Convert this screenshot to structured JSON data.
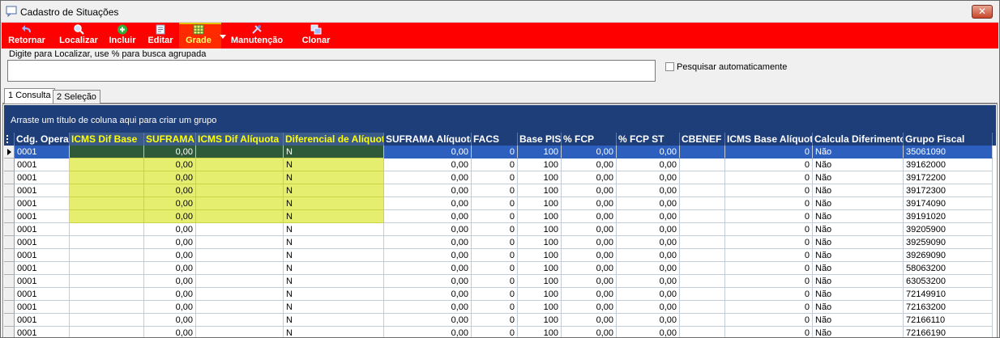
{
  "window": {
    "title": "Cadastro de Situações",
    "close_label": "✕"
  },
  "toolbar": {
    "buttons": [
      {
        "label": "Retornar",
        "icon": "back-arrow-icon"
      },
      {
        "label": "Localizar",
        "icon": "search-icon"
      },
      {
        "label": "Incluir",
        "icon": "plus-icon"
      },
      {
        "label": "Editar",
        "icon": "edit-icon"
      },
      {
        "label": "Grade",
        "icon": "grid-icon"
      },
      {
        "label": "Manutenção",
        "icon": "tools-icon"
      },
      {
        "label": "Clonar",
        "icon": "clone-icon"
      }
    ]
  },
  "search": {
    "legend": "Digite para Localizar, use % para busca agrupada",
    "value": "",
    "auto_label": "Pesquisar automaticamente"
  },
  "tabs": [
    "1 Consulta",
    "2 Seleção"
  ],
  "grid": {
    "group_hint": "Arraste um título de coluna aqui para criar um grupo",
    "columns": [
      "Cdg. Operação",
      "ICMS Dif Base",
      "SUFRAMA Alíquota",
      "ICMS Dif Alíquota",
      "Diferencial de Alíquota",
      "SUFRAMA Alíquota",
      "FACS",
      "Base PIS",
      "% FCP",
      "% FCP ST",
      "CBENEF",
      "ICMS Base Alíquota",
      "Calcula Diferimento",
      "Grupo Fiscal"
    ],
    "rows": [
      [
        "0001",
        "",
        "0,00",
        "",
        "N",
        "0,00",
        "0",
        "100",
        "0,00",
        "0,00",
        "",
        "0",
        "Não",
        "35061090"
      ],
      [
        "0001",
        "",
        "0,00",
        "",
        "N",
        "0,00",
        "0",
        "100",
        "0,00",
        "0,00",
        "",
        "0",
        "Não",
        "39162000"
      ],
      [
        "0001",
        "",
        "0,00",
        "",
        "N",
        "0,00",
        "0",
        "100",
        "0,00",
        "0,00",
        "",
        "0",
        "Não",
        "39172200"
      ],
      [
        "0001",
        "",
        "0,00",
        "",
        "N",
        "0,00",
        "0",
        "100",
        "0,00",
        "0,00",
        "",
        "0",
        "Não",
        "39172300"
      ],
      [
        "0001",
        "",
        "0,00",
        "",
        "N",
        "0,00",
        "0",
        "100",
        "0,00",
        "0,00",
        "",
        "0",
        "Não",
        "39174090"
      ],
      [
        "0001",
        "",
        "0,00",
        "",
        "N",
        "0,00",
        "0",
        "100",
        "0,00",
        "0,00",
        "",
        "0",
        "Não",
        "39191020"
      ],
      [
        "0001",
        "",
        "0,00",
        "",
        "N",
        "0,00",
        "0",
        "100",
        "0,00",
        "0,00",
        "",
        "0",
        "Não",
        "39205900"
      ],
      [
        "0001",
        "",
        "0,00",
        "",
        "N",
        "0,00",
        "0",
        "100",
        "0,00",
        "0,00",
        "",
        "0",
        "Não",
        "39259090"
      ],
      [
        "0001",
        "",
        "0,00",
        "",
        "N",
        "0,00",
        "0",
        "100",
        "0,00",
        "0,00",
        "",
        "0",
        "Não",
        "39269090"
      ],
      [
        "0001",
        "",
        "0,00",
        "",
        "N",
        "0,00",
        "0",
        "100",
        "0,00",
        "0,00",
        "",
        "0",
        "Não",
        "58063200"
      ],
      [
        "0001",
        "",
        "0,00",
        "",
        "N",
        "0,00",
        "0",
        "100",
        "0,00",
        "0,00",
        "",
        "0",
        "Não",
        "63053200"
      ],
      [
        "0001",
        "",
        "0,00",
        "",
        "N",
        "0,00",
        "0",
        "100",
        "0,00",
        "0,00",
        "",
        "0",
        "Não",
        "72149910"
      ],
      [
        "0001",
        "",
        "0,00",
        "",
        "N",
        "0,00",
        "0",
        "100",
        "0,00",
        "0,00",
        "",
        "0",
        "Não",
        "72163200"
      ],
      [
        "0001",
        "",
        "0,00",
        "",
        "N",
        "0,00",
        "0",
        "100",
        "0,00",
        "0,00",
        "",
        "0",
        "Não",
        "72166110"
      ],
      [
        "0001",
        "",
        "0,00",
        "",
        "N",
        "0,00",
        "0",
        "100",
        "0,00",
        "0,00",
        "",
        "0",
        "Não",
        "72166190"
      ]
    ],
    "selected_row": 0,
    "highlighted_rows": [
      0,
      1,
      2,
      3,
      4,
      5
    ]
  },
  "colors": {
    "toolbar": "#ff0000",
    "header": "#1e3e7a",
    "highlight": "#e6ee70",
    "selection": "#2d5fbf"
  }
}
